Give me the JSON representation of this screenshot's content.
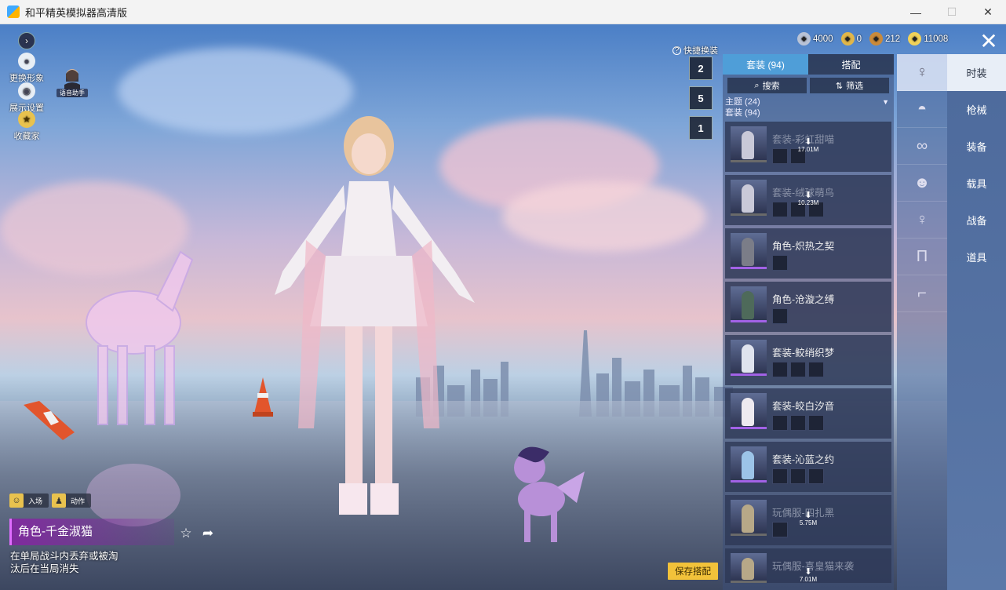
{
  "window": {
    "title": "和平精英模拟器高清版",
    "minimize": "—",
    "maximize": "☐",
    "close": "✕"
  },
  "left_menu": {
    "items": [
      {
        "label": "更换形象",
        "icon": "person-icon"
      },
      {
        "label": "展示设置",
        "icon": "eye-icon"
      },
      {
        "label": "收藏家",
        "icon": "badge-icon"
      }
    ],
    "helper_label": "语音助手"
  },
  "item_info": {
    "tags": [
      {
        "label": "入场"
      },
      {
        "label": "动作"
      }
    ],
    "name": "角色-千金淑猫",
    "description": "在单局战斗内丢弃或被淘汰后在当局消失"
  },
  "quick_change": {
    "label": "快捷换装",
    "slots": [
      "2",
      "5",
      "1"
    ]
  },
  "currency": [
    {
      "value": "4000",
      "color": "#b9c3d6"
    },
    {
      "value": "0",
      "color": "#e0b64a"
    },
    {
      "value": "212",
      "color": "#c98a3b"
    },
    {
      "value": "11008",
      "color": "#f0d25a"
    }
  ],
  "list": {
    "tabs": [
      {
        "label": "套装 (94)",
        "active": true
      },
      {
        "label": "搭配",
        "active": false
      }
    ],
    "search_label": "搜索",
    "filter_label": "筛选",
    "category_theme": "主题 (24)",
    "category_suit": "套装 (94)",
    "items": [
      {
        "name": "套装-彩虹甜喵",
        "parts": 2,
        "faded": true,
        "download": "17.01M"
      },
      {
        "name": "套装-绒球萌鸟",
        "parts": 3,
        "faded": true,
        "download": "10.23M"
      },
      {
        "name": "角色-炽热之契",
        "parts": 1,
        "faded": false,
        "download": ""
      },
      {
        "name": "角色-沧漩之缚",
        "parts": 1,
        "faded": false,
        "download": ""
      },
      {
        "name": "套装-鲛绡织梦",
        "parts": 3,
        "faded": false,
        "download": ""
      },
      {
        "name": "套装-皎白汐音",
        "parts": 3,
        "faded": false,
        "download": ""
      },
      {
        "name": "套装-沁蓝之约",
        "parts": 3,
        "faded": false,
        "download": ""
      },
      {
        "name": "玩偶服-四扎黑",
        "parts": 1,
        "faded": true,
        "download": "5.75M"
      },
      {
        "name": "玩偶服-喜皇猫来袭",
        "parts": 1,
        "faded": true,
        "download": "7.01M"
      }
    ]
  },
  "category_icons": [
    "character-icon",
    "cap-icon",
    "goggles-icon",
    "mask-icon",
    "outfit-icon",
    "pants-icon",
    "shoes-icon"
  ],
  "right_tabs": [
    {
      "label": "时装",
      "active": true
    },
    {
      "label": "枪械",
      "active": false
    },
    {
      "label": "装备",
      "active": false
    },
    {
      "label": "载具",
      "active": false
    },
    {
      "label": "战备",
      "active": false
    },
    {
      "label": "道具",
      "active": false
    }
  ],
  "save_button": "保存搭配",
  "colors": {
    "accent": "#4f9ed8",
    "rarity_purple": "#a262e6",
    "save": "#f2c23a"
  }
}
